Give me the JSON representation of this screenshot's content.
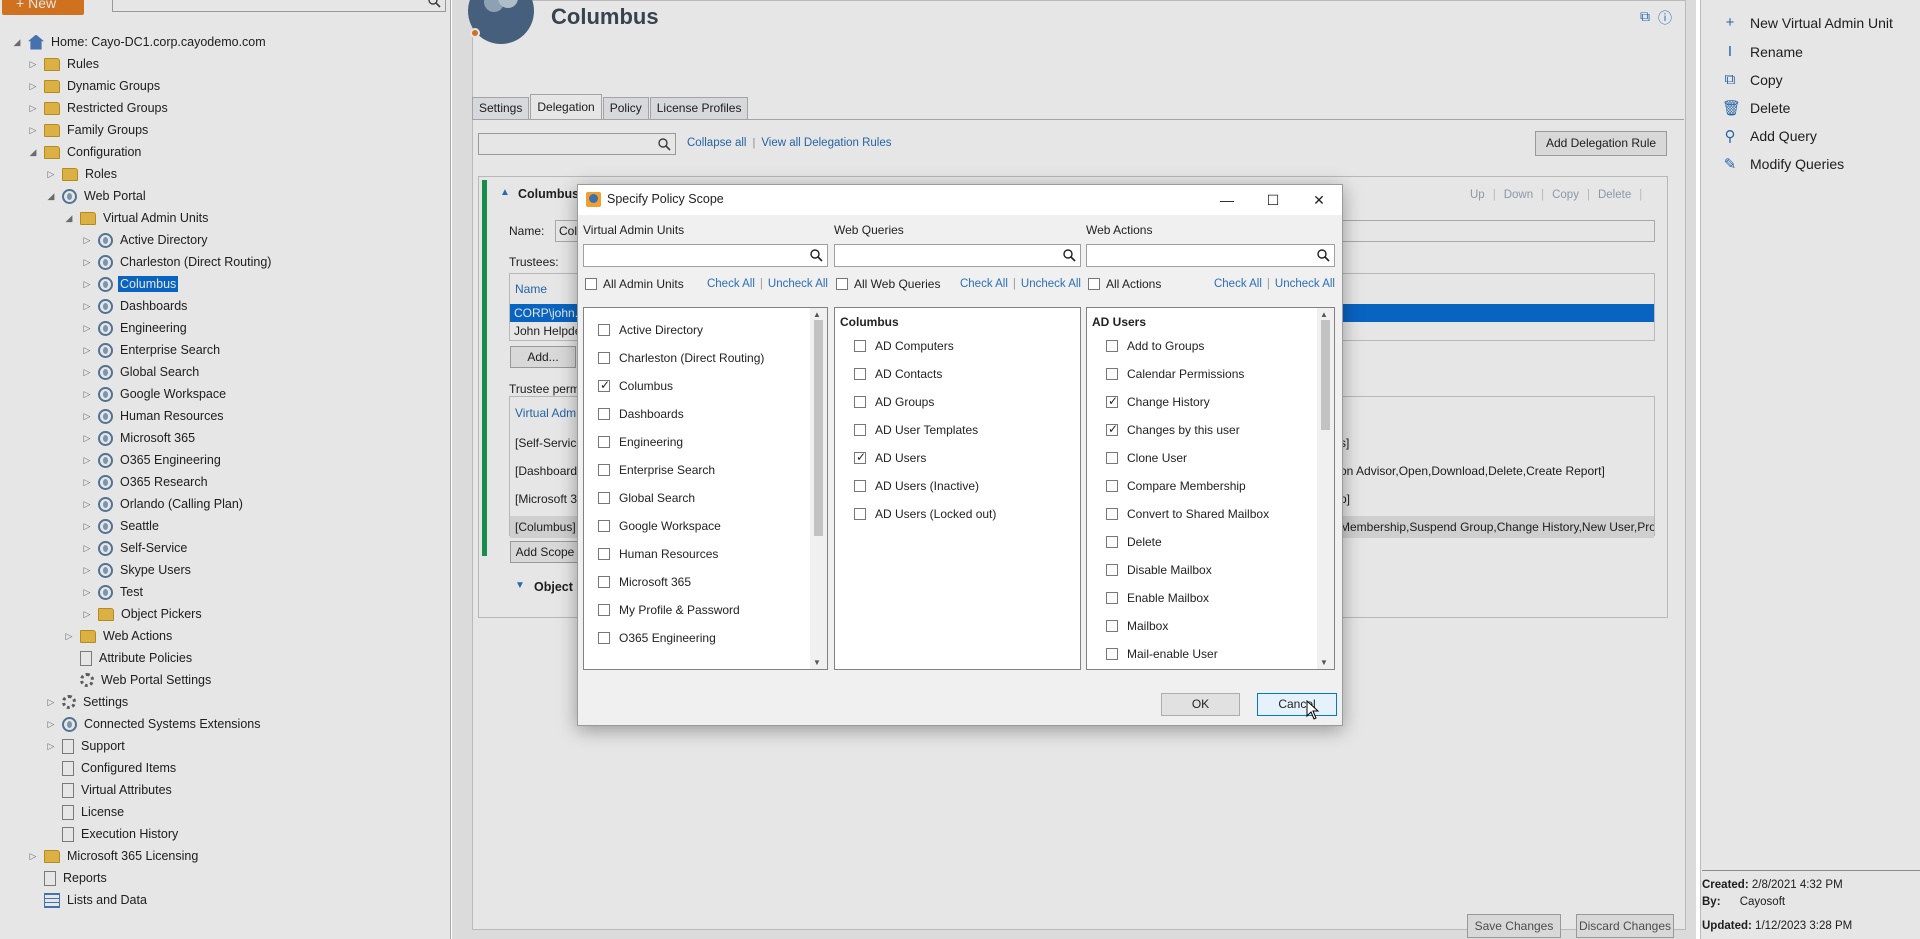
{
  "header": {
    "new_label": "New"
  },
  "tree": {
    "home": "Home: Cayo-DC1.corp.cayodemo.com",
    "rules": "Rules",
    "dynamic_groups": "Dynamic Groups",
    "restricted_groups": "Restricted Groups",
    "family_groups": "Family Groups",
    "configuration": "Configuration",
    "roles": "Roles",
    "web_portal": "Web Portal",
    "vau": "Virtual Admin Units",
    "vau_items": [
      "Active Directory",
      "Charleston (Direct Routing)",
      "Columbus",
      "Dashboards",
      "Engineering",
      "Enterprise Search",
      "Global Search",
      "Google Workspace",
      "Human Resources",
      "Microsoft 365",
      "O365 Engineering",
      "O365 Research",
      "Orlando (Calling Plan)",
      "Seattle",
      "Self-Service",
      "Skype Users",
      "Test",
      "Object Pickers"
    ],
    "web_actions": "Web Actions",
    "attribute_policies": "Attribute Policies",
    "web_portal_settings": "Web Portal Settings",
    "settings": "Settings",
    "connected_systems": "Connected Systems Extensions",
    "support": "Support",
    "configured_items": "Configured Items",
    "virtual_attributes": "Virtual Attributes",
    "license": "License",
    "execution_history": "Execution History",
    "m365_licensing": "Microsoft 365 Licensing",
    "reports": "Reports",
    "lists_and_data": "Lists and Data"
  },
  "object": {
    "title": "Columbus"
  },
  "tabs": [
    "Settings",
    "Delegation",
    "Policy",
    "License Profiles"
  ],
  "delegation": {
    "collapse_all": "Collapse all",
    "separator": "|",
    "view_all": "View all Delegation Rules",
    "add_rule": "Add Delegation Rule",
    "rule_title": "Columbus",
    "rule_actions": [
      "Up",
      "Down",
      "Copy",
      "Delete"
    ],
    "name_label": "Name:",
    "name_value": "Col",
    "trustees_label": "Trustees:",
    "name_col": "Name",
    "trustee_rows": [
      "CORP\\john.",
      "John Helpde"
    ],
    "add_btn": "Add...",
    "trustee_perm_label": "Trustee perm",
    "perm_col": "Virtual Adm",
    "perm_rows": [
      {
        "left": "[Self-Service",
        "right": "s]"
      },
      {
        "left": "[Dashboard",
        "right": "on Advisor,Open,Download,Delete,Create Report]"
      },
      {
        "left": "[Microsoft 3",
        "right": "p]"
      },
      {
        "left": "[Columbus]",
        "right": "Membership,Suspend Group,Change History,New User,Pro"
      }
    ],
    "add_scope": "Add Scope",
    "object_label": "Object I",
    "save_changes": "Save Changes",
    "discard_changes": "Discard Changes"
  },
  "actions": [
    "New Virtual Admin Unit",
    "Rename",
    "Copy",
    "Delete",
    "Add Query",
    "Modify Queries"
  ],
  "meta": {
    "created_label": "Created:",
    "created_value": "2/8/2021 4:32 PM",
    "by_label": "By:",
    "by_value": "Cayosoft",
    "updated_label": "Updated:",
    "updated_value": "1/12/2023 3:28 PM"
  },
  "dialog": {
    "title": "Specify Policy Scope",
    "columns": [
      {
        "label": "Virtual Admin Units",
        "all_label": "All Admin Units",
        "check": "Check All",
        "uncheck": "Uncheck All",
        "items": [
          {
            "t": "Active Directory",
            "c": false
          },
          {
            "t": "Charleston (Direct Routing)",
            "c": false
          },
          {
            "t": "Columbus",
            "c": true
          },
          {
            "t": "Dashboards",
            "c": false
          },
          {
            "t": "Engineering",
            "c": false
          },
          {
            "t": "Enterprise Search",
            "c": false
          },
          {
            "t": "Global Search",
            "c": false
          },
          {
            "t": "Google Workspace",
            "c": false
          },
          {
            "t": "Human Resources",
            "c": false
          },
          {
            "t": "Microsoft 365",
            "c": false
          },
          {
            "t": "My Profile & Password",
            "c": false
          },
          {
            "t": "O365 Engineering",
            "c": false
          }
        ]
      },
      {
        "label": "Web Queries",
        "all_label": "All Web Queries",
        "check": "Check All",
        "uncheck": "Uncheck All",
        "group": "Columbus",
        "items": [
          {
            "t": "AD Computers",
            "c": false
          },
          {
            "t": "AD Contacts",
            "c": false
          },
          {
            "t": "AD Groups",
            "c": false
          },
          {
            "t": "AD User Templates",
            "c": false
          },
          {
            "t": "AD Users",
            "c": true
          },
          {
            "t": "AD Users (Inactive)",
            "c": false
          },
          {
            "t": "AD Users (Locked out)",
            "c": false
          }
        ]
      },
      {
        "label": "Web Actions",
        "all_label": "All Actions",
        "check": "Check All",
        "uncheck": "Uncheck All",
        "group": "AD Users",
        "items": [
          {
            "t": "Add to Groups",
            "c": false
          },
          {
            "t": "Calendar Permissions",
            "c": false
          },
          {
            "t": "Change History",
            "c": true
          },
          {
            "t": "Changes by this user",
            "c": true
          },
          {
            "t": "Clone User",
            "c": false
          },
          {
            "t": "Compare Membership",
            "c": false
          },
          {
            "t": "Convert to Shared Mailbox",
            "c": false
          },
          {
            "t": "Delete",
            "c": false
          },
          {
            "t": "Disable Mailbox",
            "c": false
          },
          {
            "t": "Enable Mailbox",
            "c": false
          },
          {
            "t": "Mailbox",
            "c": false
          },
          {
            "t": "Mail-enable User",
            "c": false
          }
        ]
      }
    ],
    "ok": "OK",
    "cancel": "Cancel"
  }
}
